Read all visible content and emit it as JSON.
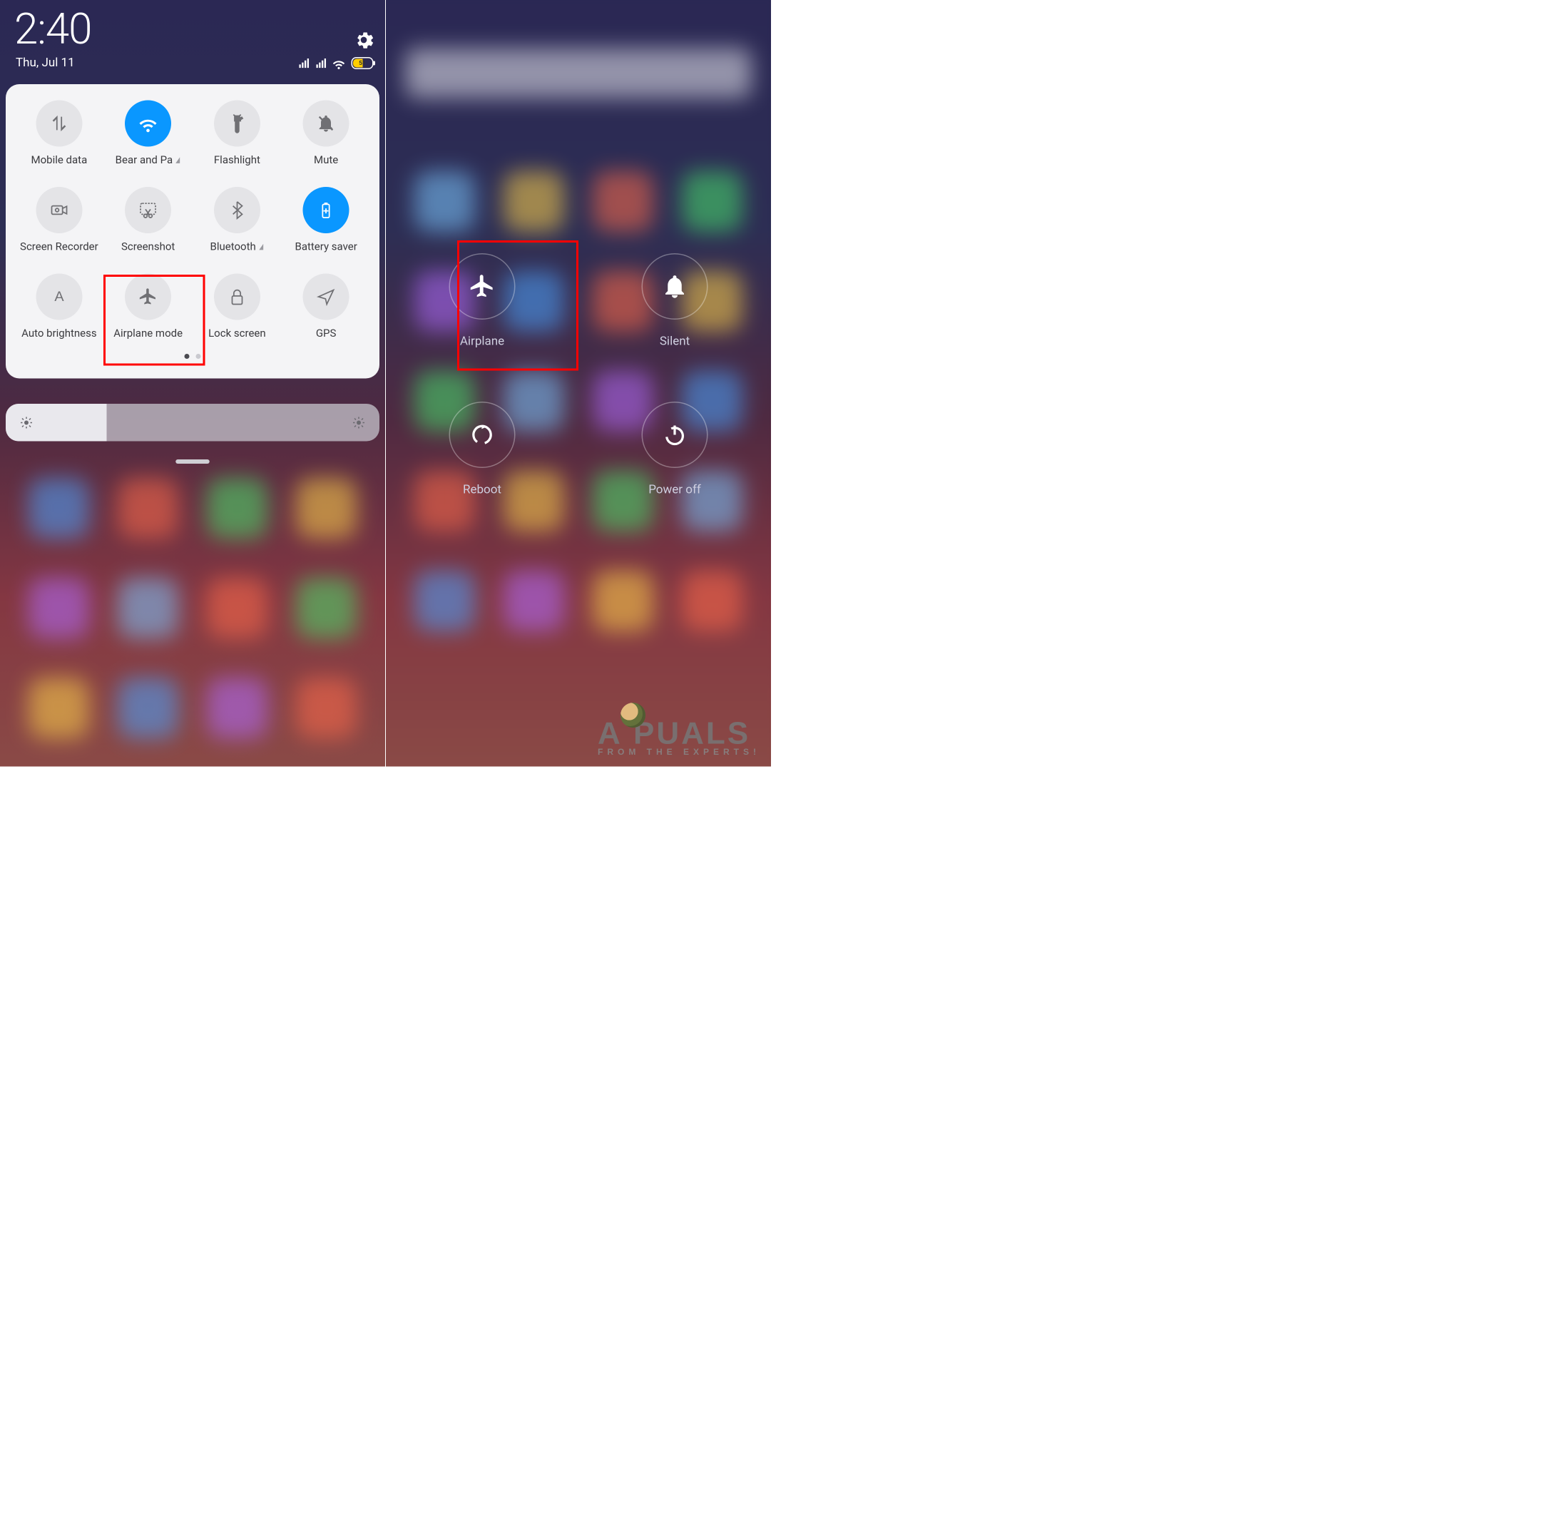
{
  "status": {
    "time": "2:40",
    "date": "Thu, Jul 11",
    "battery_percent": "51"
  },
  "icons": {
    "settings": "gear-icon",
    "signal1": "signal-icon",
    "signal2": "signal-icon",
    "wifi": "wifi-icon",
    "battery": "battery-icon"
  },
  "colors": {
    "toggle_active": "#0a97ff",
    "toggle_inactive": "#e4e4e7",
    "highlight_border": "#ff0000"
  },
  "quick_settings": {
    "tiles": [
      {
        "id": "mobile-data",
        "label": "Mobile data",
        "icon": "data-arrows-icon",
        "active": false,
        "has_chevron": false
      },
      {
        "id": "wifi-network",
        "label": "Bear and Pa",
        "icon": "wifi-icon",
        "active": true,
        "has_chevron": true
      },
      {
        "id": "flashlight",
        "label": "Flashlight",
        "icon": "flashlight-icon",
        "active": false,
        "has_chevron": false
      },
      {
        "id": "mute",
        "label": "Mute",
        "icon": "mute-bell-icon",
        "active": false,
        "has_chevron": false
      },
      {
        "id": "screen-recorder",
        "label": "Screen Recorder",
        "icon": "video-camera-icon",
        "active": false,
        "has_chevron": false
      },
      {
        "id": "screenshot",
        "label": "Screenshot",
        "icon": "scissors-icon",
        "active": false,
        "has_chevron": false
      },
      {
        "id": "bluetooth",
        "label": "Bluetooth",
        "icon": "bluetooth-icon",
        "active": false,
        "has_chevron": true
      },
      {
        "id": "battery-saver",
        "label": "Battery saver",
        "icon": "battery-plus-icon",
        "active": true,
        "has_chevron": false
      },
      {
        "id": "auto-brightness",
        "label": "Auto brightness",
        "icon": "letter-a-icon",
        "active": false,
        "has_chevron": false
      },
      {
        "id": "airplane-mode",
        "label": "Airplane mode",
        "icon": "airplane-icon",
        "active": false,
        "has_chevron": false,
        "highlighted": true
      },
      {
        "id": "lock-screen",
        "label": "Lock screen",
        "icon": "lock-icon",
        "active": false,
        "has_chevron": false
      },
      {
        "id": "gps",
        "label": "GPS",
        "icon": "location-arrow-icon",
        "active": false,
        "has_chevron": false
      }
    ],
    "page_count": 2,
    "current_page": 0
  },
  "brightness": {
    "level_percent": 25
  },
  "power_menu": {
    "items": [
      {
        "id": "airplane",
        "label": "Airplane",
        "icon": "airplane-icon",
        "highlighted": true
      },
      {
        "id": "silent",
        "label": "Silent",
        "icon": "bell-icon",
        "highlighted": false
      },
      {
        "id": "reboot",
        "label": "Reboot",
        "icon": "reboot-icon",
        "highlighted": false
      },
      {
        "id": "power-off",
        "label": "Power off",
        "icon": "power-icon",
        "highlighted": false
      }
    ]
  },
  "watermark": {
    "brand_left": "A",
    "brand_right": "PUALS",
    "tagline": "FROM THE EXPERTS!"
  }
}
